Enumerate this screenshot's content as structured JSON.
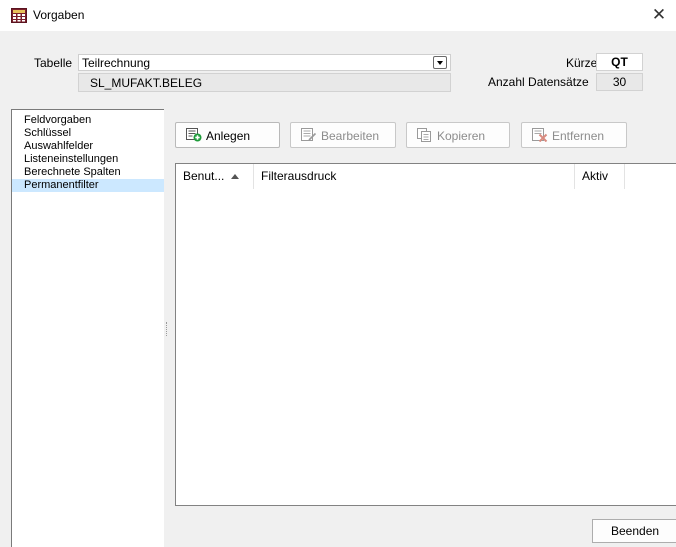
{
  "window": {
    "title": "Vorgaben",
    "close_glyph": "✕",
    "icon": "table-grid-icon"
  },
  "form": {
    "tabelle_label": "Tabelle",
    "tabelle_value": "Teilrechnung",
    "table_name": "SL_MUFAKT.BELEG",
    "kuerzel_label": "Kürzel",
    "kuerzel_value": "QT",
    "anzahl_label": "Anzahl Datensätze",
    "anzahl_value": "30"
  },
  "sidebar": {
    "items": [
      {
        "label": "Feldvorgaben",
        "selected": false
      },
      {
        "label": "Schlüssel",
        "selected": false
      },
      {
        "label": "Auswahlfelder",
        "selected": false
      },
      {
        "label": "Listeneinstellungen",
        "selected": false
      },
      {
        "label": "Berechnete Spalten",
        "selected": false
      },
      {
        "label": "Permanentfilter",
        "selected": true
      }
    ],
    "selected_color": "#cce8ff"
  },
  "toolbar": {
    "anlegen": {
      "label": "Anlegen",
      "icon": "add-record-icon",
      "enabled": true
    },
    "bearbeiten": {
      "label": "Bearbeiten",
      "icon": "edit-record-icon",
      "enabled": false
    },
    "kopieren": {
      "label": "Kopieren",
      "icon": "copy-record-icon",
      "enabled": false
    },
    "entfernen": {
      "label": "Entfernen",
      "icon": "delete-record-icon",
      "enabled": false
    }
  },
  "grid": {
    "columns": [
      {
        "label": "Benut...",
        "sorted": "ascending"
      },
      {
        "label": "Filterausdruck"
      },
      {
        "label": "Aktiv"
      }
    ],
    "rows": []
  },
  "footer": {
    "beenden_label": "Beenden"
  },
  "colors": {
    "accent_green": "#1e9b3a",
    "delete_red": "#c0392b",
    "dialog_bg": "#f0f0f0"
  }
}
